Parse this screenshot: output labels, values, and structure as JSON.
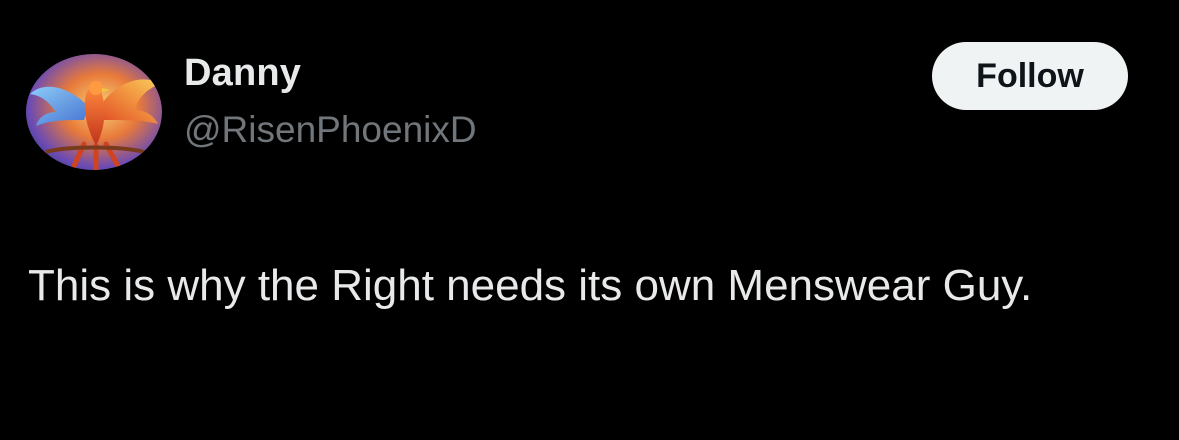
{
  "author": {
    "display_name": "Danny",
    "handle": "@RisenPhoenixD",
    "avatar_icon": "phoenix-avatar-icon"
  },
  "actions": {
    "follow_label": "Follow"
  },
  "tweet": {
    "text": "This is why the Right needs its own Menswear Guy."
  },
  "colors": {
    "background": "#000000",
    "primary_text": "#e7e9ea",
    "secondary_text": "#71767b",
    "follow_button_bg": "#eff3f4",
    "follow_button_text": "#0f1419"
  }
}
